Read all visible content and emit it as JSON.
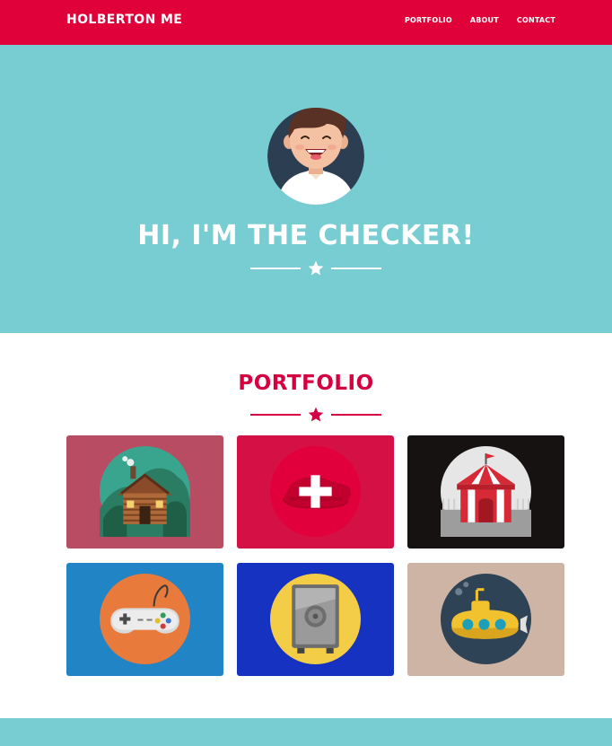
{
  "navbar": {
    "brand": "HOLBERTON ME",
    "links": [
      {
        "label": "PORTFOLIO"
      },
      {
        "label": "ABOUT"
      },
      {
        "label": "CONTACT"
      }
    ],
    "color": "#e0003a"
  },
  "hero": {
    "title": "HI, I'M THE CHECKER!",
    "background": "#78cdd2",
    "avatar_icon": "avatar-icon",
    "divider_icon": "star-icon"
  },
  "portfolio": {
    "title": "PORTFOLIO",
    "divider_icon": "star-icon",
    "items": [
      {
        "icon": "cabin-icon",
        "background": "#b84c63"
      },
      {
        "icon": "safe-plus-icon",
        "background": "#d51044"
      },
      {
        "icon": "circus-tent-icon",
        "background": "#151211"
      },
      {
        "icon": "gamepad-icon",
        "background": "#2184c5"
      },
      {
        "icon": "safe-icon",
        "background": "#1632c0"
      },
      {
        "icon": "submarine-icon",
        "background": "#ceb4a4"
      }
    ]
  }
}
